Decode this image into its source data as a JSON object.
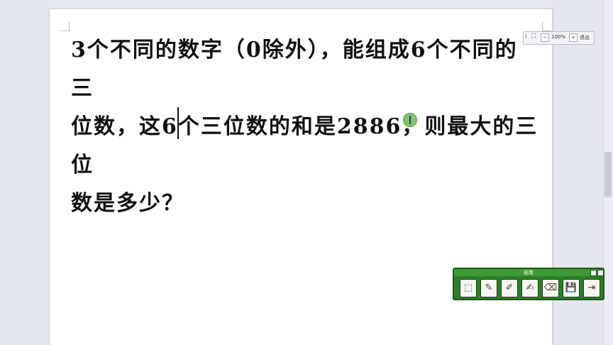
{
  "document": {
    "line1": "3个不同的数字（0除外），能组成6个不同的三",
    "line2": "位数，这6个三位数的和是2886，则最大的三位",
    "line3": "数是多少？"
  },
  "zoom_toolbar": {
    "minus_label": "−",
    "zoom_value": "100%",
    "plus_label": "+",
    "exit_label": "退出"
  },
  "pen_toolbar": {
    "title": "画笔",
    "tools": [
      {
        "name": "select-icon",
        "glyph": "⬚"
      },
      {
        "name": "pen-icon",
        "glyph": "✎"
      },
      {
        "name": "highlighter-icon",
        "glyph": "✐"
      },
      {
        "name": "brush-icon",
        "glyph": "✍"
      },
      {
        "name": "eraser-icon",
        "glyph": "⌫"
      },
      {
        "name": "save-icon",
        "glyph": "💾"
      },
      {
        "name": "exit-icon",
        "glyph": "⇥"
      }
    ]
  },
  "colors": {
    "pen_toolbar_green": "#2f7d2a",
    "cursor_dot": "#7dc46a"
  }
}
